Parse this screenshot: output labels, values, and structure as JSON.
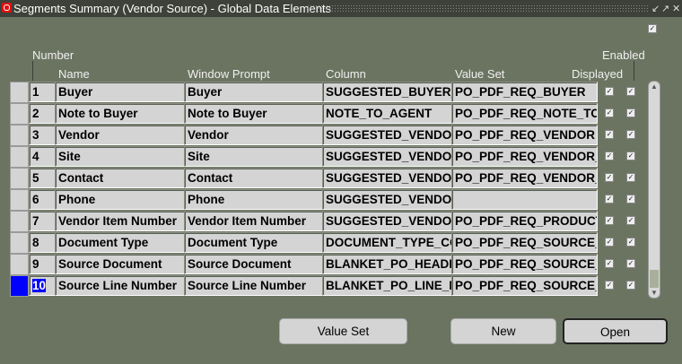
{
  "window": {
    "title": "Segments Summary (Vendor Source) - Global Data Elements"
  },
  "headers": {
    "number": "Number",
    "name": "Name",
    "window_prompt": "Window Prompt",
    "column": "Column",
    "value_set": "Value Set",
    "displayed": "Displayed",
    "enabled": "Enabled"
  },
  "rows": [
    {
      "number": "1",
      "name": "Buyer",
      "prompt": "Buyer",
      "column": "SUGGESTED_BUYER_",
      "value_set": "PO_PDF_REQ_BUYER",
      "displayed": true,
      "enabled": true
    },
    {
      "number": "2",
      "name": "Note to Buyer",
      "prompt": "Note to Buyer",
      "column": "NOTE_TO_AGENT",
      "value_set": "PO_PDF_REQ_NOTE_TO",
      "displayed": true,
      "enabled": true
    },
    {
      "number": "3",
      "name": "Vendor",
      "prompt": "Vendor",
      "column": "SUGGESTED_VENDOR",
      "value_set": "PO_PDF_REQ_VENDOR",
      "displayed": true,
      "enabled": true
    },
    {
      "number": "4",
      "name": "Site",
      "prompt": "Site",
      "column": "SUGGESTED_VENDOR",
      "value_set": "PO_PDF_REQ_VENDOR_",
      "displayed": true,
      "enabled": true
    },
    {
      "number": "5",
      "name": "Contact",
      "prompt": "Contact",
      "column": "SUGGESTED_VENDOR",
      "value_set": "PO_PDF_REQ_VENDOR_",
      "displayed": true,
      "enabled": true
    },
    {
      "number": "6",
      "name": "Phone",
      "prompt": "Phone",
      "column": "SUGGESTED_VENDOR",
      "value_set": "",
      "displayed": true,
      "enabled": true
    },
    {
      "number": "7",
      "name": "Vendor Item Number",
      "prompt": "Vendor Item Number",
      "column": "SUGGESTED_VENDOR",
      "value_set": "PO_PDF_REQ_PRODUCT",
      "displayed": true,
      "enabled": true
    },
    {
      "number": "8",
      "name": "Document Type",
      "prompt": "Document Type",
      "column": "DOCUMENT_TYPE_CO",
      "value_set": "PO_PDF_REQ_SOURCE_",
      "displayed": true,
      "enabled": true
    },
    {
      "number": "9",
      "name": "Source Document",
      "prompt": "Source Document",
      "column": "BLANKET_PO_HEADE",
      "value_set": "PO_PDF_REQ_SOURCE_",
      "displayed": true,
      "enabled": true
    },
    {
      "number": "10",
      "name": "Source Line Number",
      "prompt": "Source Line Number",
      "column": "BLANKET_PO_LINE_N",
      "value_set": "PO_PDF_REQ_SOURCE_",
      "displayed": true,
      "enabled": true
    }
  ],
  "current_row": 9,
  "buttons": {
    "value_set": "Value Set",
    "new": "New",
    "open": "Open"
  }
}
